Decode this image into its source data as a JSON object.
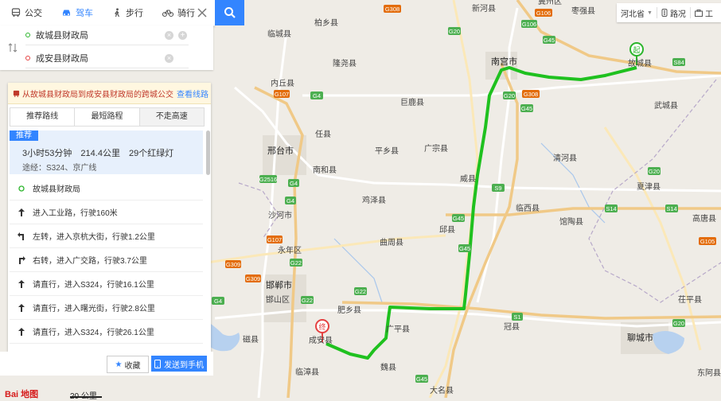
{
  "modes": [
    {
      "label": "公交",
      "icon": "bus-icon",
      "active": false
    },
    {
      "label": "驾车",
      "icon": "car-icon",
      "active": true
    },
    {
      "label": "步行",
      "icon": "walk-icon",
      "active": false
    },
    {
      "label": "骑行",
      "icon": "bike-icon",
      "active": false
    }
  ],
  "route": {
    "start": "故城县财政局",
    "end": "成安县财政局"
  },
  "tip": {
    "text": "从故城县财政局到成安县财政局的跨城公交",
    "link": "查看线路"
  },
  "tabs": [
    "推荐路线",
    "最短路程",
    "不走高速"
  ],
  "summary": {
    "badge": "推荐",
    "time": "3小时53分钟",
    "distance": "214.4公里",
    "lights": "29个红绿灯",
    "via": "途经：S324、京广线"
  },
  "steps": [
    {
      "text": "故城县财政局",
      "icon": "start-dot-icon"
    },
    {
      "text": "进入工业路，行驶160米",
      "icon": "straight-arrow-icon"
    },
    {
      "text": "左转，进入京杭大街，行驶1.2公里",
      "icon": "turn-left-icon"
    },
    {
      "text": "右转，进入广交路，行驶3.7公里",
      "icon": "turn-right-icon"
    },
    {
      "text": "请直行，进入S324，行驶16.1公里",
      "icon": "straight-arrow-icon"
    },
    {
      "text": "请直行，进入曙光街，行驶2.8公里",
      "icon": "straight-arrow-icon"
    },
    {
      "text": "请直行，进入S324，行驶26.1公里",
      "icon": "straight-arrow-icon"
    }
  ],
  "buttons": {
    "favorite": "收藏",
    "send": "发送到手机"
  },
  "topright": {
    "region": "河北省",
    "traffic": "路况",
    "tools": "工"
  },
  "map": {
    "start_marker": "起",
    "end_marker": "终",
    "scale": "20 公里",
    "logo": "Bai 地图",
    "route_color": "#1fc11f",
    "cities": [
      {
        "name": "邢台市"
      },
      {
        "name": "邯郸市"
      },
      {
        "name": "聊城市"
      },
      {
        "name": "南宫市"
      }
    ],
    "labels": [
      "新河县",
      "枣强县",
      "冀州区",
      "临城县",
      "柏乡县",
      "隆尧县",
      "内丘县",
      "巨鹿县",
      "任县",
      "武城县",
      "平乡县",
      "广宗县",
      "南和县",
      "威县",
      "清河县",
      "夏津县",
      "鸡泽县",
      "临西县",
      "沙河市",
      "邱县",
      "高唐县",
      "永年区",
      "曲周县",
      "馆陶县",
      "冠县",
      "肥乡县",
      "广平县",
      "茌平县",
      "邯山区",
      "成安县",
      "磁县",
      "魏县",
      "临漳县",
      "东阿县",
      "大名县",
      "故城县"
    ]
  }
}
